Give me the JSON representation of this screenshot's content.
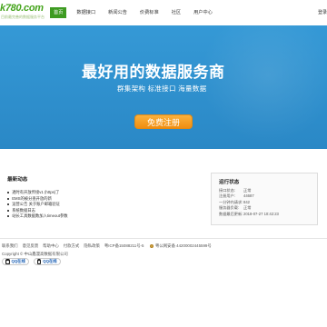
{
  "header": {
    "logo_text": "k780.com",
    "logo_sub": "目前最完善的数据服务平台",
    "nav": [
      "首页",
      "数据接口",
      "新闻公告",
      "价费标准",
      "社区",
      "用户中心"
    ],
    "active_index": 0,
    "user_link": "登录"
  },
  "hero": {
    "title": "最好用的数据服务商",
    "subtitle": "群集架构 标准接口 海量数据",
    "button": "免费注册"
  },
  "news": {
    "title": "最新动态",
    "items": [
      "透时有开放传接v1 (https)了",
      "EMS的被分查开放的新",
      "运营公告 关于账户邮箱验证",
      "系统数据日志",
      "站长工具数据数加入timeout参数"
    ]
  },
  "status": {
    "title": "运行状态",
    "rows": [
      {
        "key": "接口状态:",
        "value": "正常"
      },
      {
        "key": "注册用户:",
        "value": "44687"
      },
      {
        "key": "一分钟内请求:",
        "value": "842"
      },
      {
        "key": "服务器负载:",
        "value": "正常"
      },
      {
        "key": "数据最后更新:",
        "value": "2018-07-27 10:42:23"
      }
    ]
  },
  "footer": {
    "links": [
      "联系我们",
      "意见反馈",
      "帮助中心",
      "付款方式",
      "隐私政策"
    ],
    "icp": "粤ICP备15088211号-5",
    "police": "粤公网安备 44200002445599号",
    "copyright": "Copyright © 中山鑫漫高数据有限公司",
    "badges": [
      "QQ在线",
      "QQ在线"
    ]
  },
  "colors": {
    "brand_green": "#3d9b21",
    "hero_blue": "#2f91cf",
    "cta_orange": "#f5a020"
  }
}
